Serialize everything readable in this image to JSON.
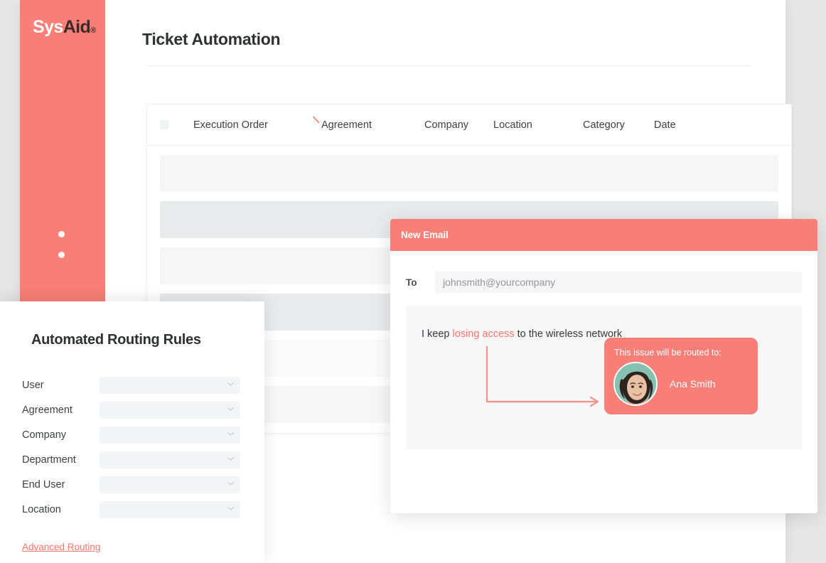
{
  "brand": {
    "logo_sys": "Sys",
    "logo_aid": "Aid",
    "logo_tm": "®",
    "accent_color": "#f87f77",
    "link_color": "#f8756c",
    "page_background": "#e6e6e6",
    "panel_background": "#ffffff"
  },
  "header": {
    "title": "Ticket Automation"
  },
  "table": {
    "select_all_checkbox": "",
    "columns": [
      {
        "label": "Execution Order",
        "sorted": false
      },
      {
        "label": "Agreement",
        "sorted": true
      },
      {
        "label": "Company",
        "sorted": false
      },
      {
        "label": "Location",
        "sorted": false
      },
      {
        "label": "Category",
        "sorted": false
      },
      {
        "label": "Date",
        "sorted": false
      }
    ],
    "rows": [
      {
        "state": "default"
      },
      {
        "state": "hover"
      },
      {
        "state": "default"
      },
      {
        "state": "hover"
      },
      {
        "state": "pale"
      },
      {
        "state": "default"
      }
    ]
  },
  "routing_panel": {
    "title": "Automated Routing Rules",
    "fields": [
      {
        "label": "User",
        "value": "",
        "icon": "chevron-down-icon"
      },
      {
        "label": "Agreement",
        "value": "",
        "icon": "chevron-down-icon"
      },
      {
        "label": "Company",
        "value": "",
        "icon": "chevron-down-icon"
      },
      {
        "label": "Department",
        "value": "",
        "icon": "chevron-down-icon"
      },
      {
        "label": "End User",
        "value": "",
        "icon": "chevron-down-icon"
      },
      {
        "label": "Location",
        "value": "",
        "icon": "chevron-down-icon"
      }
    ],
    "advanced_link": "Advanced Routing"
  },
  "email_panel": {
    "title": "New Email",
    "to_label": "To",
    "to_placeholder": "johnsmith@yourcompany",
    "to_value": "",
    "body": {
      "text_before": "I keep ",
      "highlight": "losing access",
      "text_after": " to the wireless network"
    },
    "routed_card": {
      "label": "This issue will be routed to:",
      "name": "Ana Smith",
      "avatar_alt": "avatar"
    }
  },
  "sidebar": {
    "nav_dots": [
      "nav-dot-1",
      "nav-dot-2"
    ]
  }
}
